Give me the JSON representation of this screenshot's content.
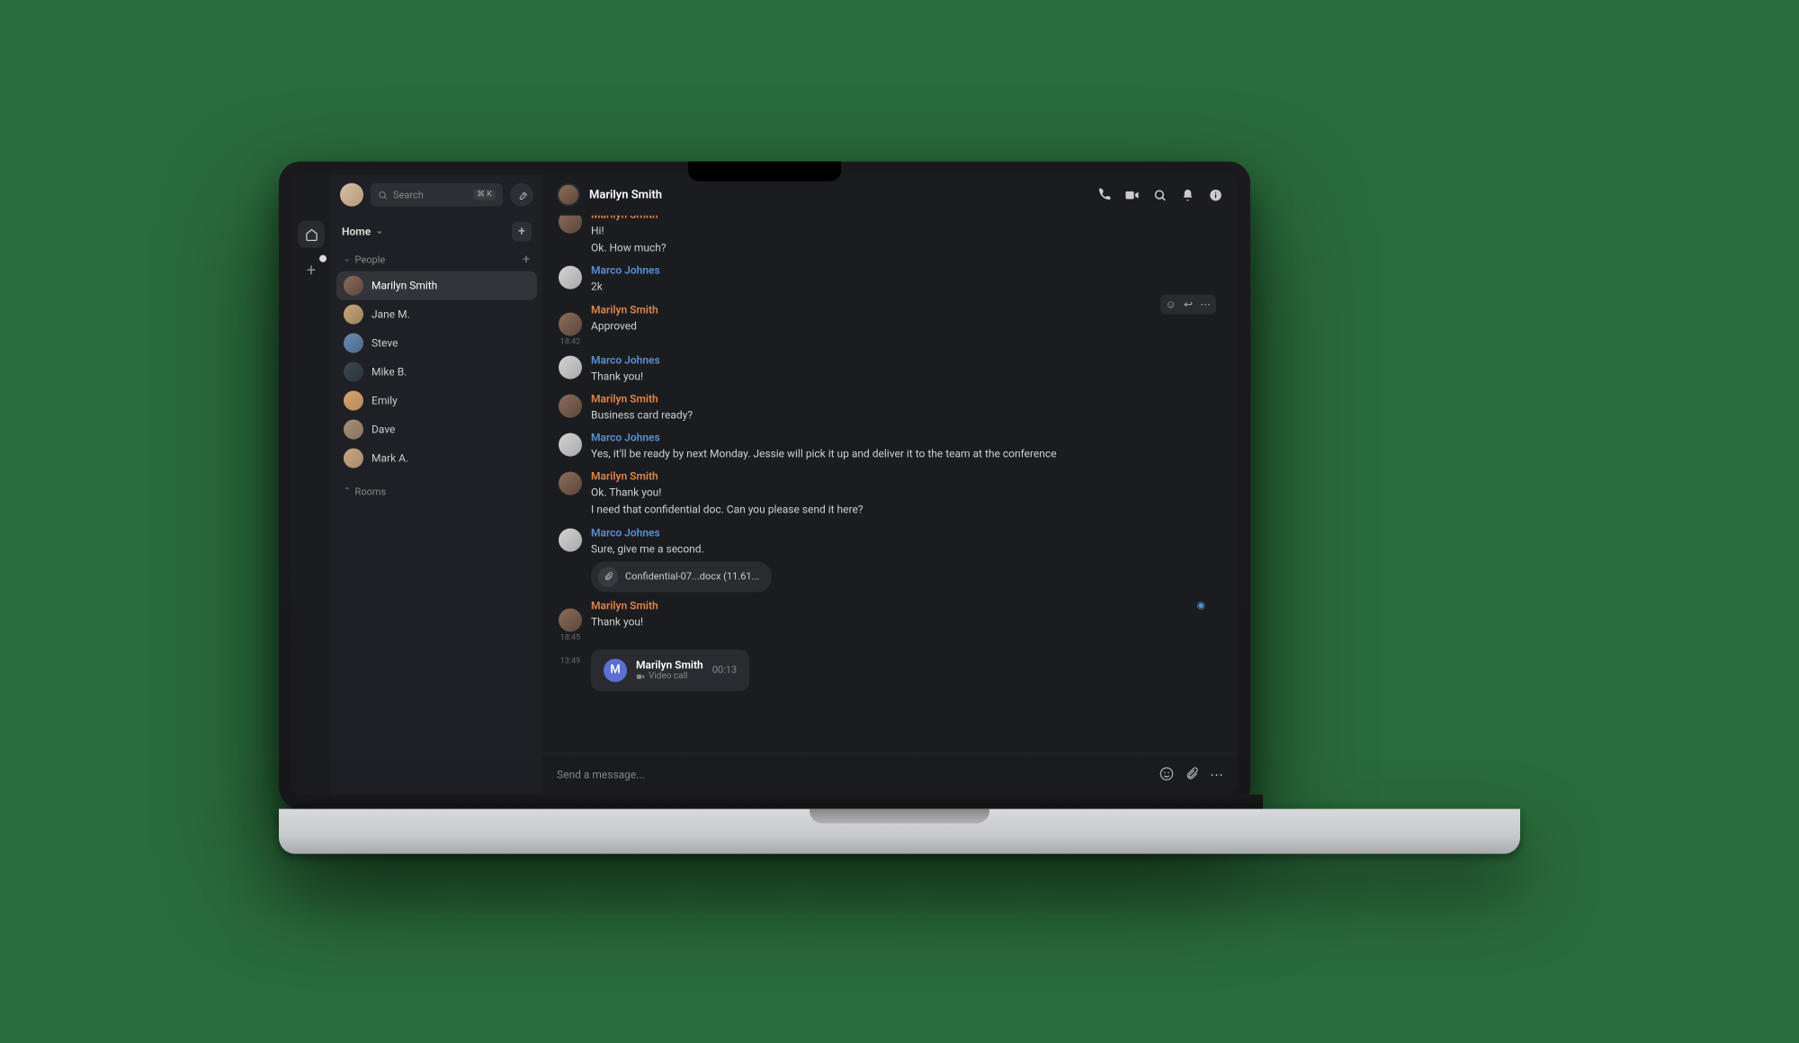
{
  "header": {
    "search_placeholder": "Search",
    "search_shortcut": "⌘ K"
  },
  "nav": {
    "home_label": "Home",
    "people_label": "People",
    "rooms_label": "Rooms"
  },
  "people": [
    {
      "name": "Marilyn Smith",
      "active": true,
      "avatar": "pa1"
    },
    {
      "name": "Jane M.",
      "avatar": "pa2"
    },
    {
      "name": "Steve",
      "avatar": "pa3"
    },
    {
      "name": "Mike B.",
      "avatar": "pa4"
    },
    {
      "name": "Emily",
      "avatar": "pa5"
    },
    {
      "name": "Dave",
      "avatar": "pa6"
    },
    {
      "name": "Mark A.",
      "avatar": "pa7"
    }
  ],
  "chat": {
    "title": "Marilyn Smith",
    "composer_placeholder": "Send a message...",
    "attachment": {
      "name": "Confidential-07...docx (11.61...",
      "icon": "paperclip"
    },
    "call": {
      "name": "Marilyn Smith",
      "sub": "Video call",
      "duration": "00:13",
      "time": "13:49",
      "initial": "M"
    },
    "messages": [
      {
        "sender": "Marilyn Smith",
        "cls": "marilyn",
        "avatar": "ma-m",
        "partial_top": true,
        "lines": [
          "Hi!",
          "Ok. How much?"
        ]
      },
      {
        "sender": "Marco Johnes",
        "cls": "marco",
        "avatar": "ma-j",
        "lines": [
          "2k"
        ]
      },
      {
        "sender": "Marilyn Smith",
        "cls": "marilyn",
        "avatar": "ma-m",
        "time": "18:42",
        "show_actions": true,
        "lines": [
          "Approved"
        ]
      },
      {
        "sender": "Marco Johnes",
        "cls": "marco",
        "avatar": "ma-j",
        "lines": [
          "Thank you!"
        ]
      },
      {
        "sender": "Marilyn Smith",
        "cls": "marilyn",
        "avatar": "ma-m",
        "lines": [
          "Business card ready?"
        ]
      },
      {
        "sender": "Marco Johnes",
        "cls": "marco",
        "avatar": "ma-j",
        "lines": [
          "Yes, it'll be ready by next Monday. Jessie will pick it up and deliver it to the team at the conference"
        ]
      },
      {
        "sender": "Marilyn Smith",
        "cls": "marilyn",
        "avatar": "ma-m",
        "lines": [
          "Ok. Thank you!",
          "I need that confidential doc. Can you please send it here?"
        ]
      },
      {
        "sender": "Marco Johnes",
        "cls": "marco",
        "avatar": "ma-j",
        "lines": [
          "Sure, give me a second."
        ],
        "attachment": true
      },
      {
        "sender": "Marilyn Smith",
        "cls": "marilyn",
        "avatar": "ma-m",
        "time": "18:45",
        "lines": [
          "Thank you!"
        ],
        "read": true
      }
    ]
  }
}
